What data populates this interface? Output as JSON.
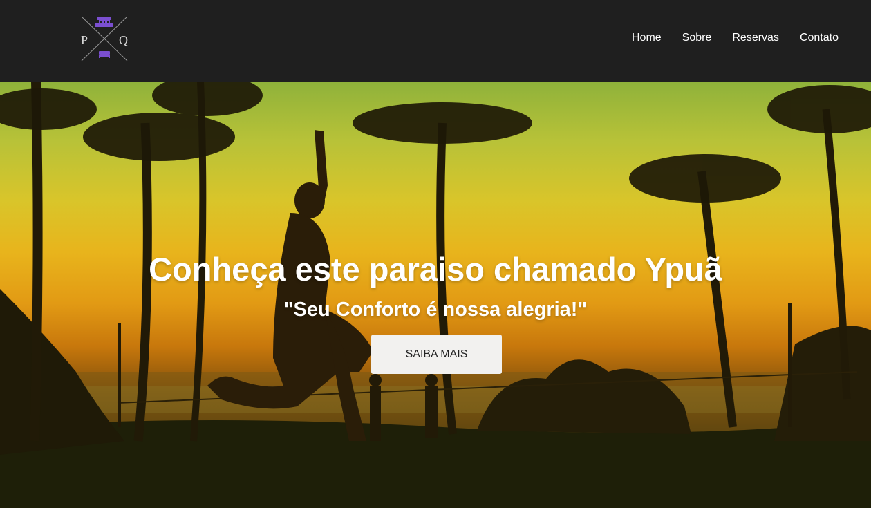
{
  "header": {
    "logo": {
      "letter_left": "P",
      "letter_right": "Q",
      "icon_top": "hotel-building-icon",
      "icon_bottom": "bed-icon",
      "icon_color": "#7b4fd0"
    },
    "nav": [
      {
        "label": "Home"
      },
      {
        "label": "Sobre"
      },
      {
        "label": "Reservas"
      },
      {
        "label": "Contato"
      }
    ]
  },
  "hero": {
    "title": "Conheça este paraiso chamado Ypuã",
    "subtitle": "\"Seu Conforto é nossa alegria!\"",
    "button_label": "SAIBA MAIS",
    "background": "sunset-beach-palms-slackline-photo"
  },
  "colors": {
    "header_bg": "#1f1f1f",
    "text": "#ffffff",
    "button_bg": "#f2f1ef"
  }
}
